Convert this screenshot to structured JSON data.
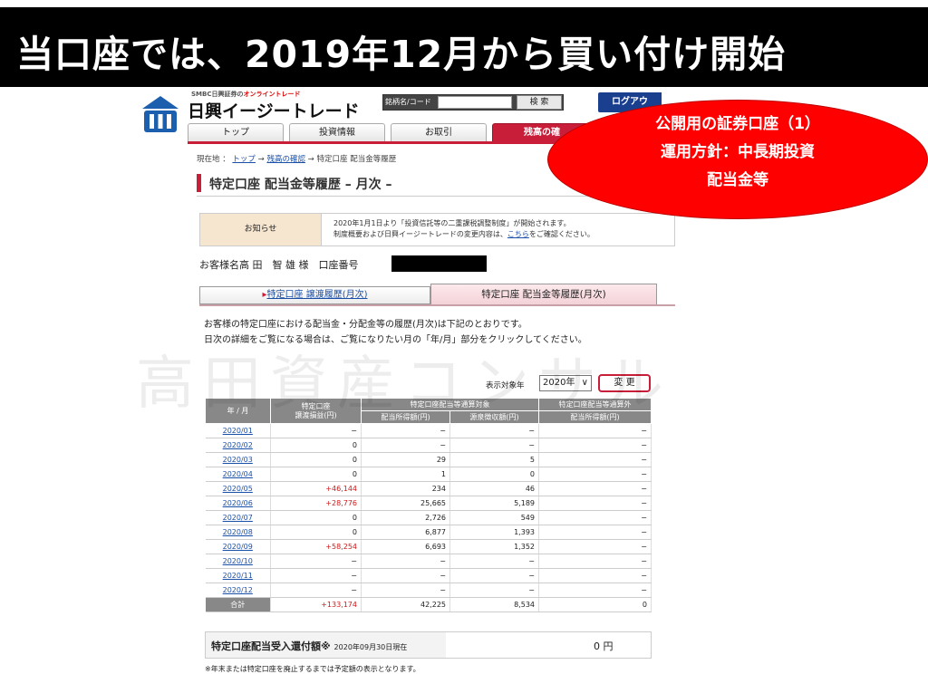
{
  "banner": {
    "title": "当口座では、2019年12月から買い付け開始"
  },
  "header": {
    "brand_small_1": "SMBC日興証券の",
    "brand_small_2": "オンライントレード",
    "brand_name": "日興イージートレード",
    "search_label": "銘柄名/コード",
    "search_value": "",
    "search_button": "検 索",
    "login_button": "ログアウ"
  },
  "nav": {
    "tabs": [
      "トップ",
      "投資情報",
      "お取引",
      "残高の確"
    ],
    "active_index": 3
  },
  "breadcrumb": {
    "prefix": "現在地 ：",
    "top": "トップ",
    "arrow1": "→",
    "balance": "残高の確認",
    "arrow2": "→",
    "current": "特定口座 配当金等履歴"
  },
  "page_title": "特定口座 配当金等履歴 – 月次 –",
  "notice": {
    "label": "お知らせ",
    "line1": "2020年1月1日より「投資信託等の二重課税調整制度」が開始されます。",
    "line2_pre": "制度概要および日興イージートレードの変更内容は、",
    "line2_link": "こちら",
    "line2_post": "をご確認ください。"
  },
  "customer": {
    "label": "お客様名",
    "name": "高 田　智 雄 様",
    "account_label": "口座番号"
  },
  "subtabs": {
    "left_prefix": "▸",
    "left": "特定口座 譲渡履歴(月次)",
    "right": "特定口座 配当金等履歴(月次)"
  },
  "intro": {
    "line1": "お客様の特定口座における配当金・分配金等の履歴(月次)は下記のとおりです。",
    "line2": "日次の詳細をご覧になる場合は、ご覧になりたい月の「年/月」部分をクリックしてください。"
  },
  "selector": {
    "label": "表示対象年",
    "value": "2020年",
    "button": "変 更"
  },
  "table": {
    "headers": {
      "month": "年 / 月",
      "transfer": "特定口座\n譲渡損益(円)",
      "group_in": "特定口座配当等通算対象",
      "group_out": "特定口座配当等通算外",
      "dividend_in": "配当所得額(円)",
      "withholding": "源泉徴収額(円)",
      "dividend_out": "配当所得額(円)"
    },
    "rows": [
      {
        "month": "2020/01",
        "transfer": "−",
        "dividend": "−",
        "withholding": "−",
        "outside": "−"
      },
      {
        "month": "2020/02",
        "transfer": "0",
        "dividend": "−",
        "withholding": "−",
        "outside": "−"
      },
      {
        "month": "2020/03",
        "transfer": "0",
        "dividend": "29",
        "withholding": "5",
        "outside": "−"
      },
      {
        "month": "2020/04",
        "transfer": "0",
        "dividend": "1",
        "withholding": "0",
        "outside": "−"
      },
      {
        "month": "2020/05",
        "transfer": "+46,144",
        "dividend": "234",
        "withholding": "46",
        "outside": "−"
      },
      {
        "month": "2020/06",
        "transfer": "+28,776",
        "dividend": "25,665",
        "withholding": "5,189",
        "outside": "−"
      },
      {
        "month": "2020/07",
        "transfer": "0",
        "dividend": "2,726",
        "withholding": "549",
        "outside": "−"
      },
      {
        "month": "2020/08",
        "transfer": "0",
        "dividend": "6,877",
        "withholding": "1,393",
        "outside": "−"
      },
      {
        "month": "2020/09",
        "transfer": "+58,254",
        "dividend": "6,693",
        "withholding": "1,352",
        "outside": "−"
      },
      {
        "month": "2020/10",
        "transfer": "−",
        "dividend": "−",
        "withholding": "−",
        "outside": "−"
      },
      {
        "month": "2020/11",
        "transfer": "−",
        "dividend": "−",
        "withholding": "−",
        "outside": "−"
      },
      {
        "month": "2020/12",
        "transfer": "−",
        "dividend": "−",
        "withholding": "−",
        "outside": "−"
      }
    ],
    "total": {
      "label": "合計",
      "transfer": "+133,174",
      "dividend": "42,225",
      "withholding": "8,534",
      "outside": "0"
    }
  },
  "refund": {
    "label": "特定口座配当受入還付額※",
    "date": "2020年09月30日現在",
    "value": "0 円"
  },
  "footnote": "※年末または特定口座を廃止するまでは予定額の表示となります。",
  "watermark": "高田資産コンサル",
  "callout": {
    "line1": "公開用の証券口座（1）",
    "line2": "運用方針：中長期投資",
    "line3": "配当金等"
  },
  "colors": {
    "accent_red": "#c81e3a",
    "positive_red": "#d01a1a",
    "link_blue": "#1a4fa8"
  }
}
